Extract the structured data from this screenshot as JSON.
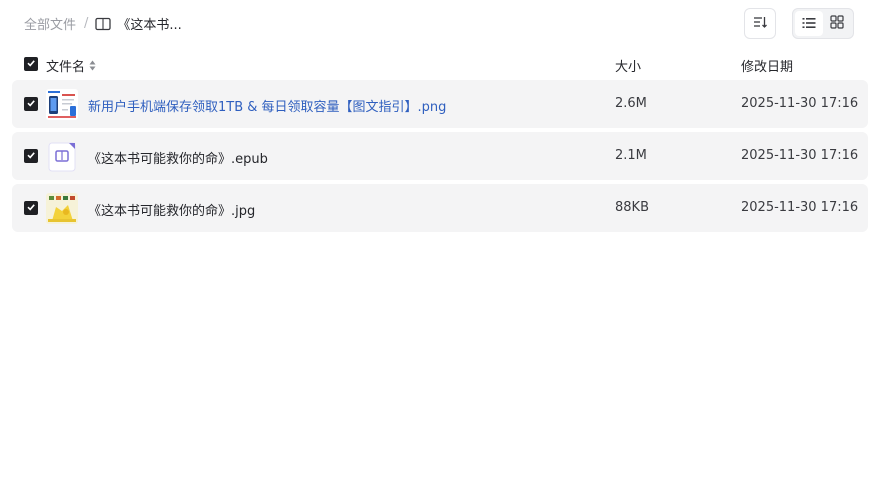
{
  "breadcrumb": {
    "root": "全部文件",
    "separator": "/",
    "current": "《这本书..."
  },
  "toolbar": {
    "sort_icon": "sort-icon",
    "list_view_icon": "list-view-icon",
    "grid_view_icon": "grid-view-icon",
    "active_view": "list"
  },
  "table": {
    "columns": {
      "name": "文件名",
      "size": "大小",
      "modified": "修改日期"
    },
    "all_selected": true,
    "rows": [
      {
        "name": "新用户手机端保存领取1TB & 每日领取容量【图文指引】.png",
        "size": "2.6M",
        "modified": "2025-11-30 17:16",
        "type": "png",
        "selected": true
      },
      {
        "name": "《这本书可能救你的命》.epub",
        "size": "2.1M",
        "modified": "2025-11-30 17:16",
        "type": "epub",
        "selected": true
      },
      {
        "name": "《这本书可能救你的命》.jpg",
        "size": "88KB",
        "modified": "2025-11-30 17:16",
        "type": "jpg",
        "selected": true
      }
    ]
  },
  "colors": {
    "link": "#2f5fbf",
    "row_bg": "#f4f4f5",
    "checkbox": "#1f2024",
    "epub_icon": "#7b6fd6"
  }
}
